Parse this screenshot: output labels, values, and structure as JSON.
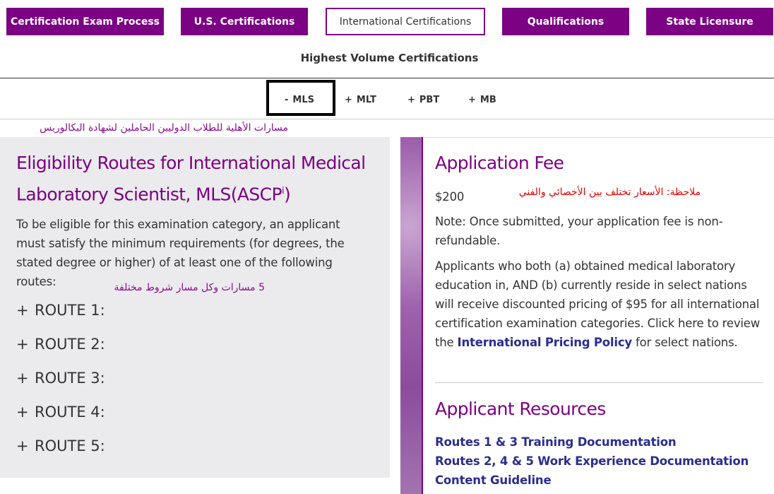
{
  "nav": {
    "buttons": [
      {
        "label": "Certification Exam Process"
      },
      {
        "label": "U.S. Certifications"
      },
      {
        "label": "International Certifications"
      },
      {
        "label": "Qualifications"
      },
      {
        "label": "State Licensure"
      }
    ],
    "active_index": 2,
    "accent_color": "#7b0282"
  },
  "section_heading": "Highest Volume Certifications",
  "subtabs": [
    {
      "symbol": "-",
      "label": "MLS"
    },
    {
      "symbol": "+",
      "label": "MLT"
    },
    {
      "symbol": "+",
      "label": "PBT"
    },
    {
      "symbol": "+",
      "label": "MB"
    }
  ],
  "annotations": {
    "eligibility_note": "مسارات الأهلية للطلاب الدوليين الحاملين لشهادة البكالوريس",
    "routes_note": "5 مسارات وكل مسار شروط مختلفة",
    "fee_note": "ملاحظة: الأسعار تختلف بين الأخصائي والفني"
  },
  "left": {
    "title": "Eligibility Routes for International Medical Laboratory Scientist, MLS(ASCP",
    "title_sup": "i",
    "title_end": ")",
    "intro": "To be eligible for this examination category, an applicant must satisfy the minimum requirements (for degrees, the stated degree or higher) of at least one of the following routes:",
    "routes": [
      {
        "symbol": "+",
        "label": "ROUTE 1:"
      },
      {
        "symbol": "+",
        "label": "ROUTE 2:"
      },
      {
        "symbol": "+",
        "label": "ROUTE 3:"
      },
      {
        "symbol": "+",
        "label": "ROUTE 4:"
      },
      {
        "symbol": "+",
        "label": "ROUTE 5:"
      }
    ]
  },
  "right": {
    "fee_heading": "Application Fee",
    "fee_amount": "$200",
    "fee_note": "Note: Once submitted, your application fee is non-refundable.",
    "discount_text": "Applicants who both (a) obtained medical laboratory education in, AND (b) currently reside in select nations will receive discounted pricing of $95 for all international certification examination categories. Click here to review the",
    "discount_link": "International Pricing Policy",
    "discount_tail": "for select nations.",
    "resources_heading": "Applicant Resources",
    "resources_links": [
      "Routes 1 & 3 Training Documentation",
      "Routes 2, 4 & 5 Work Experience Documentation",
      "Content Guideline"
    ]
  }
}
